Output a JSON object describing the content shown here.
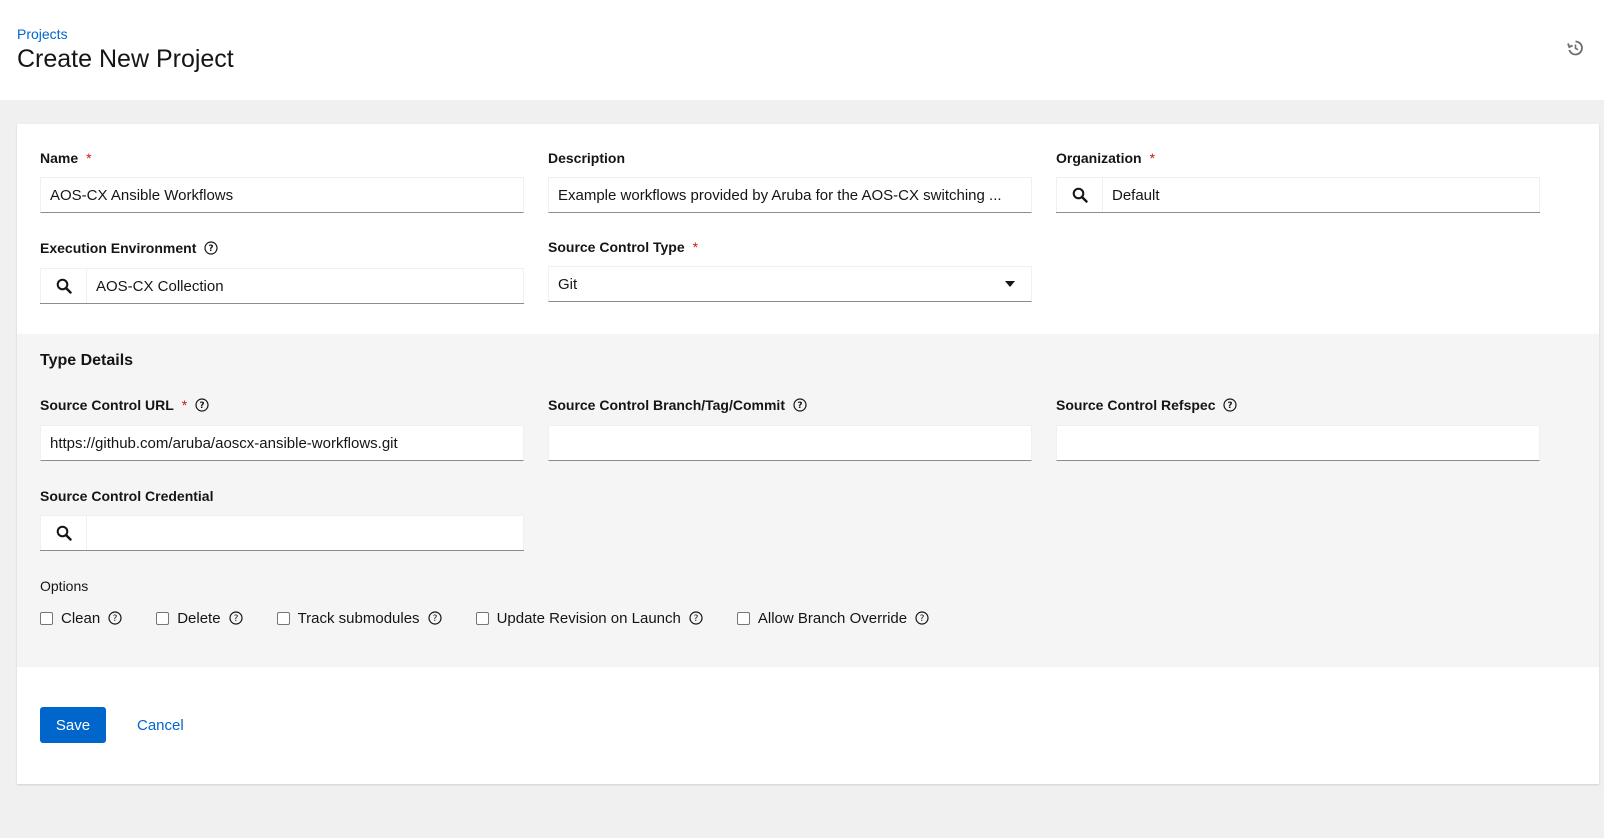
{
  "header": {
    "breadcrumb": "Projects",
    "title": "Create New Project",
    "history_icon": "history-icon"
  },
  "form": {
    "name": {
      "label": "Name",
      "required_mark": "*",
      "value": "AOS-CX Ansible Workflows"
    },
    "description": {
      "label": "Description",
      "value": "Example workflows provided by Aruba for the AOS-CX switching ..."
    },
    "organization": {
      "label": "Organization",
      "required_mark": "*",
      "value": "Default",
      "icon": "search-icon"
    },
    "execution_environment": {
      "label": "Execution Environment",
      "value": "AOS-CX Collection",
      "icon": "search-icon"
    },
    "source_control_type": {
      "label": "Source Control Type",
      "required_mark": "*",
      "value": "Git"
    }
  },
  "type_details": {
    "title": "Type Details",
    "url": {
      "label": "Source Control URL",
      "required_mark": "*",
      "value": "https://github.com/aruba/aoscx-ansible-workflows.git"
    },
    "branch": {
      "label": "Source Control Branch/Tag/Commit",
      "value": ""
    },
    "refspec": {
      "label": "Source Control Refspec",
      "value": ""
    },
    "credential": {
      "label": "Source Control Credential",
      "value": "",
      "icon": "search-icon"
    },
    "options": {
      "label": "Options",
      "items": [
        {
          "label": "Clean",
          "checked": false
        },
        {
          "label": "Delete",
          "checked": false
        },
        {
          "label": "Track submodules",
          "checked": false
        },
        {
          "label": "Update Revision on Launch",
          "checked": false
        },
        {
          "label": "Allow Branch Override",
          "checked": false
        }
      ]
    }
  },
  "actions": {
    "save": "Save",
    "cancel": "Cancel"
  },
  "colors": {
    "accent": "#0066cc",
    "required": "#c9190b",
    "section_bg": "#f5f5f5",
    "page_bg": "#f0f0f0"
  }
}
